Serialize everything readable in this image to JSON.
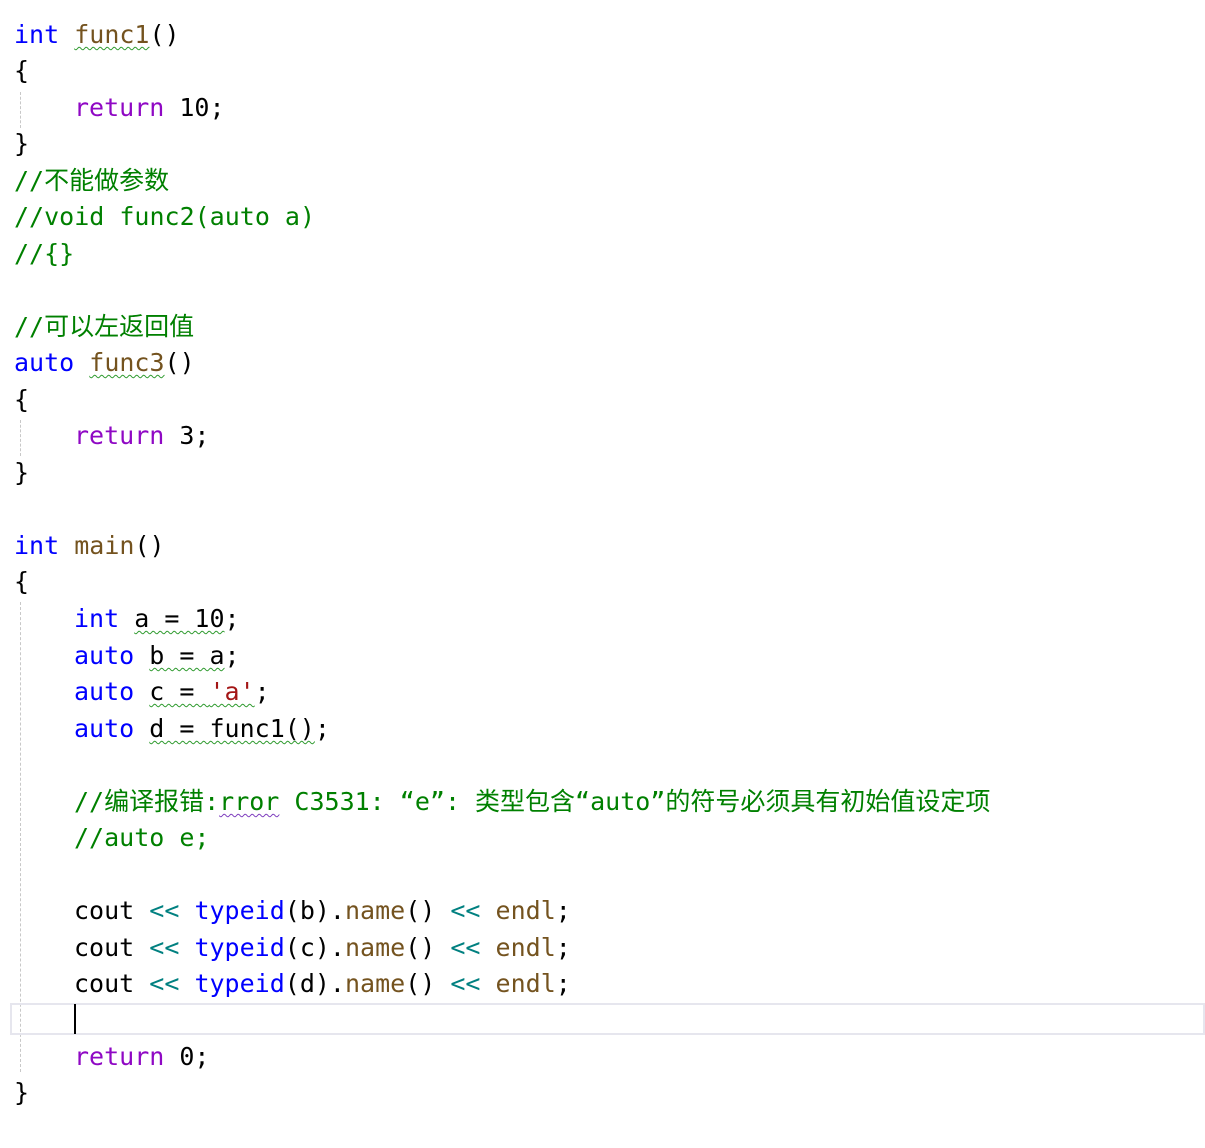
{
  "editor": {
    "func1": {
      "kw": "int",
      "name": "func1",
      "parens": "()",
      "open": "{",
      "ret_kw": "return",
      "ret_val": " 10;",
      "close": "}"
    },
    "comments": {
      "no_param": "//不能做参数",
      "void_func2": "//void func2(auto a)",
      "braces": "//{}",
      "can_return": "//可以左返回值"
    },
    "func3": {
      "kw": "auto",
      "name": "func3",
      "parens": "()",
      "open": "{",
      "ret_kw": "return",
      "ret_val": " 3;",
      "close": "}"
    },
    "main": {
      "kw": "int",
      "name": "main",
      "parens": "()",
      "open": "{",
      "decl_a": {
        "type": "int",
        "rest": "a = 10",
        "end": ";"
      },
      "decl_b": {
        "type": "auto",
        "rest": "b = a",
        "end": ";"
      },
      "decl_c": {
        "type": "auto",
        "rest_pre": "c = ",
        "char": "'a'",
        "end": ";"
      },
      "decl_d": {
        "type": "auto",
        "rest": "d = func1()",
        "end": ";"
      },
      "err_comment_pre": "//编译报错:",
      "err_comment_word": "rror",
      "err_comment_post": " C3531: “e”: 类型包含“auto”的符号必须具有初始值设定项",
      "auto_e_comment": "//auto e;",
      "cout_lines": [
        {
          "cout": "cout",
          "op1": "<<",
          "typeid": "typeid",
          "arg": "(b)",
          "dot": ".",
          "name": "name",
          "call": "()",
          "op2": "<<",
          "endl": "endl",
          "semi": ";"
        },
        {
          "cout": "cout",
          "op1": "<<",
          "typeid": "typeid",
          "arg": "(c)",
          "dot": ".",
          "name": "name",
          "call": "()",
          "op2": "<<",
          "endl": "endl",
          "semi": ";"
        },
        {
          "cout": "cout",
          "op1": "<<",
          "typeid": "typeid",
          "arg": "(d)",
          "dot": ".",
          "name": "name",
          "call": "()",
          "op2": "<<",
          "endl": "endl",
          "semi": ";"
        }
      ],
      "ret_kw": "return",
      "ret_val": " 0;",
      "close": "}"
    }
  },
  "colors": {
    "keyword": "#0000ff",
    "control": "#8f08c4",
    "comment": "#008000",
    "string": "#a31515",
    "function": "#74531f",
    "operator": "#008080"
  }
}
